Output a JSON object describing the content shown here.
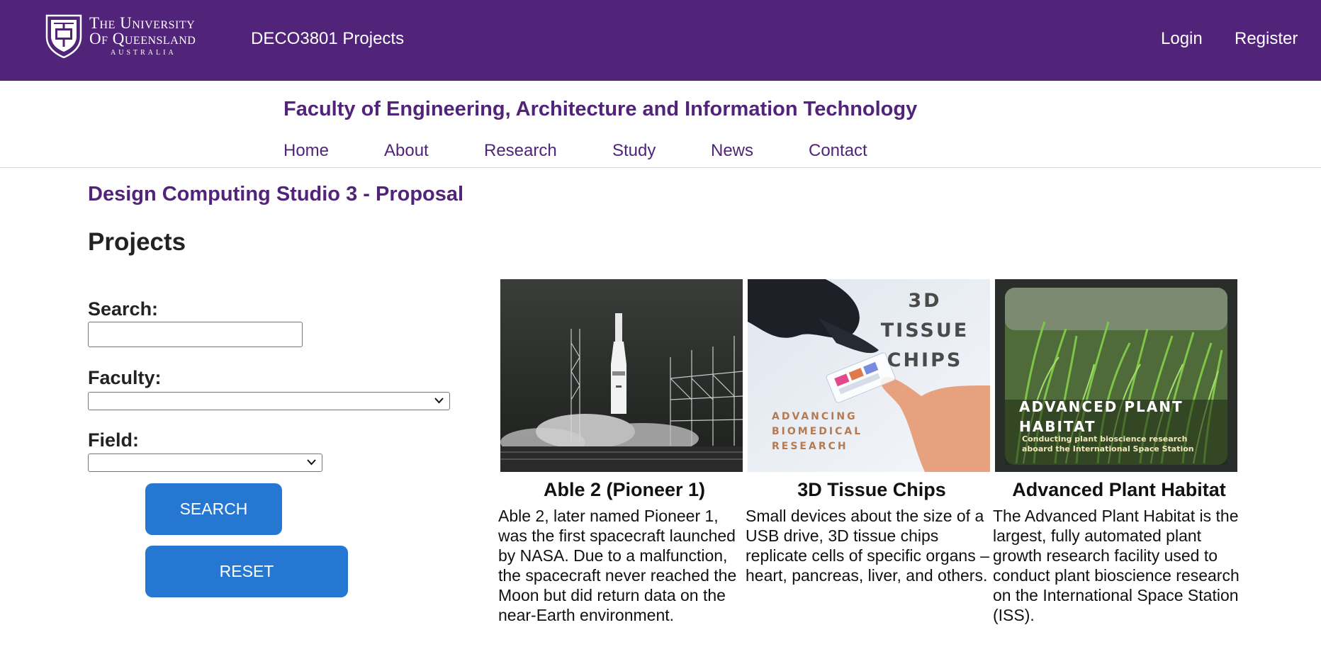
{
  "header": {
    "logo": {
      "line1": "The University",
      "line2": "Of Queensland",
      "line3": "AUSTRALIA",
      "icon": "uq-crest-icon"
    },
    "site_title": "DECO3801 Projects",
    "login_label": "Login",
    "register_label": "Register"
  },
  "faculty": {
    "title": "Faculty of Engineering, Architecture and Information Technology",
    "nav": [
      "Home",
      "About",
      "Research",
      "Study",
      "News",
      "Contact"
    ]
  },
  "page": {
    "heading": "Design Computing Studio 3 - Proposal",
    "section_heading": "Projects"
  },
  "filters": {
    "search_label": "Search:",
    "search_value": "",
    "faculty_label": "Faculty:",
    "faculty_value": "",
    "field_label": "Field:",
    "field_value": "",
    "search_button": "SEARCH",
    "reset_button": "RESET"
  },
  "projects": [
    {
      "title": "Able 2 (Pioneer 1)",
      "description": "Able 2, later named Pioneer 1, was the first spacecraft launched by NASA. Due to a malfunction, the spacecraft never reached the Moon but did return data on the near-Earth environment.",
      "image": "rocket-launch-photo"
    },
    {
      "title": "3D Tissue Chips",
      "description": "Small devices about the size of a USB drive, 3D tissue chips replicate cells of specific organs – heart, pancreas, liver, and others.",
      "image": "tissue-chip-photo",
      "image_text": {
        "heading_lines": [
          "3D",
          "TISSUE",
          "CHIPS"
        ],
        "sub_lines": [
          "ADVANCING",
          "BIOMEDICAL",
          "RESEARCH"
        ]
      }
    },
    {
      "title": "Advanced Plant Habitat",
      "description": "The Advanced Plant Habitat is the largest, fully automated plant growth research facility used to conduct plant bioscience research on the International Space Station (ISS).",
      "image": "plant-habitat-photo",
      "image_text": {
        "heading_lines": [
          "ADVANCED PLANT",
          "HABITAT"
        ],
        "sub_lines": [
          "Conducting plant bioscience research",
          "aboard the International Space Station"
        ]
      }
    }
  ],
  "colors": {
    "brand_purple": "#51247a",
    "button_blue": "#2577d2"
  }
}
